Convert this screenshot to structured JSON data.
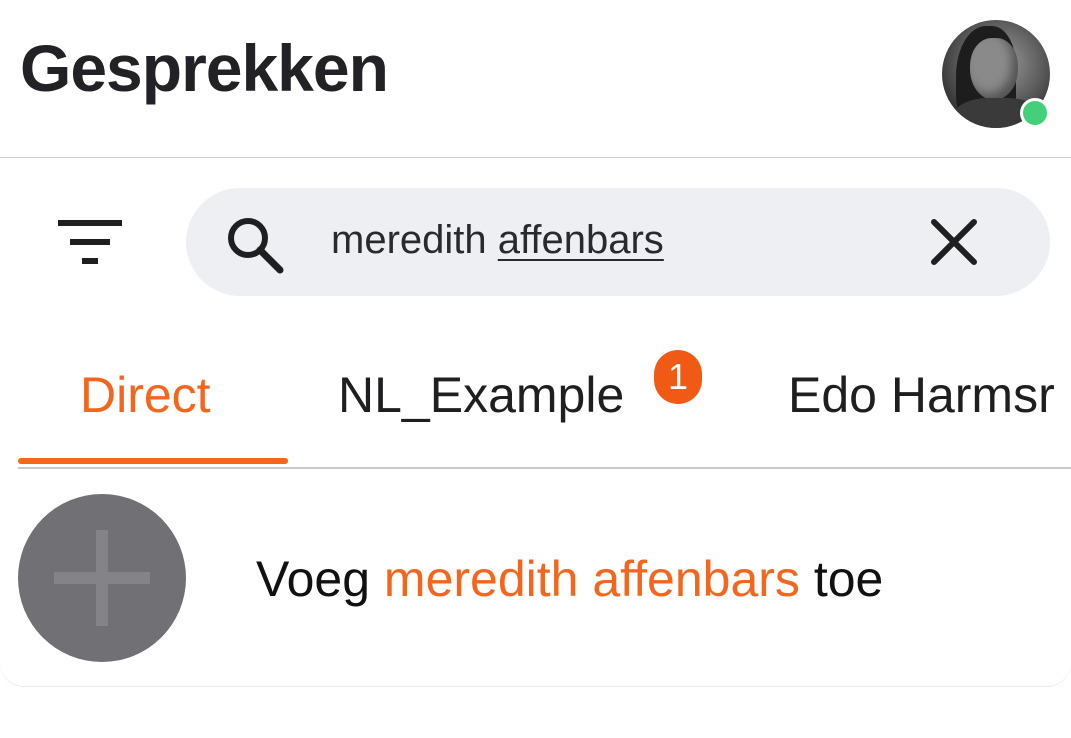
{
  "header": {
    "title": "Gesprekken"
  },
  "search": {
    "value_first": "meredith",
    "value_second": "affenbars",
    "value": "meredith affenbars"
  },
  "tabs": [
    {
      "label": "Direct",
      "active": true
    },
    {
      "label": "NL_Example",
      "badge": "1"
    },
    {
      "label": "Edo Harmsr"
    }
  ],
  "result": {
    "prefix": "Voeg",
    "highlight": "meredith affenbars",
    "suffix": "toe"
  },
  "colors": {
    "accent": "#f4661e",
    "badge": "#f05a14",
    "online": "#44d07a",
    "search_bg": "#eeeff3",
    "add_circle": "#707075"
  },
  "icons": {
    "filter": "filter-icon",
    "search": "search-icon",
    "clear": "close-icon",
    "add": "plus-icon",
    "avatar": "avatar"
  }
}
